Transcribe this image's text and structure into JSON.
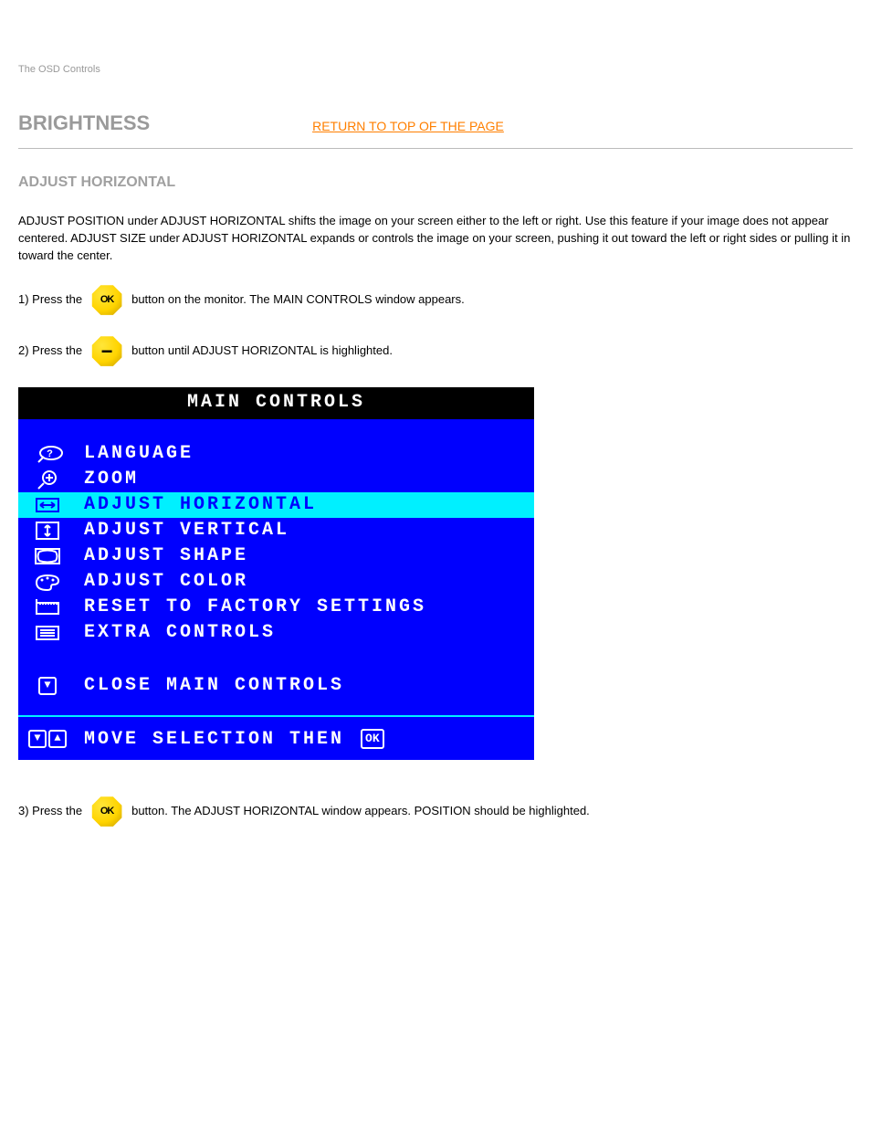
{
  "eyebrow": "The OSD Controls",
  "page_title": "BRIGHTNESS",
  "section_link": "RETURN TO TOP OF THE PAGE",
  "section_heading": "ADJUST HORIZONTAL",
  "intro": "ADJUST POSITION under ADJUST HORIZONTAL shifts the image on your screen either to the left or right. Use this feature if your image does not appear centered. ADJUST SIZE under ADJUST HORIZONTAL expands or controls the image on your screen, pushing it out toward the left or right sides or pulling it in toward the center.",
  "steps": {
    "s1_pre": "1) Press the",
    "s1_post": "button on the monitor. The MAIN CONTROLS window appears.",
    "s2_pre": "2) Press the",
    "s2_post": "button until ADJUST HORIZONTAL is highlighted.",
    "s3_pre": "3) Press the",
    "s3_post": "button. The ADJUST HORIZONTAL window appears. POSITION should be highlighted."
  },
  "buttons": {
    "ok": "OK",
    "minus": "−"
  },
  "osd": {
    "title": "MAIN CONTROLS",
    "items": [
      {
        "icon": "speech",
        "label": "LANGUAGE",
        "sel": false
      },
      {
        "icon": "zoom",
        "label": "ZOOM",
        "sel": false
      },
      {
        "icon": "horiz",
        "label": "ADJUST HORIZONTAL",
        "sel": true
      },
      {
        "icon": "vert",
        "label": "ADJUST VERTICAL",
        "sel": false
      },
      {
        "icon": "shape",
        "label": "ADJUST SHAPE",
        "sel": false
      },
      {
        "icon": "color",
        "label": "ADJUST COLOR",
        "sel": false
      },
      {
        "icon": "reset",
        "label": "RESET TO FACTORY SETTINGS",
        "sel": false
      },
      {
        "icon": "extra",
        "label": "EXTRA CONTROLS",
        "sel": false
      }
    ],
    "close": "CLOSE MAIN CONTROLS",
    "footer_text": "MOVE SELECTION THEN",
    "footer_ok": "OK"
  }
}
